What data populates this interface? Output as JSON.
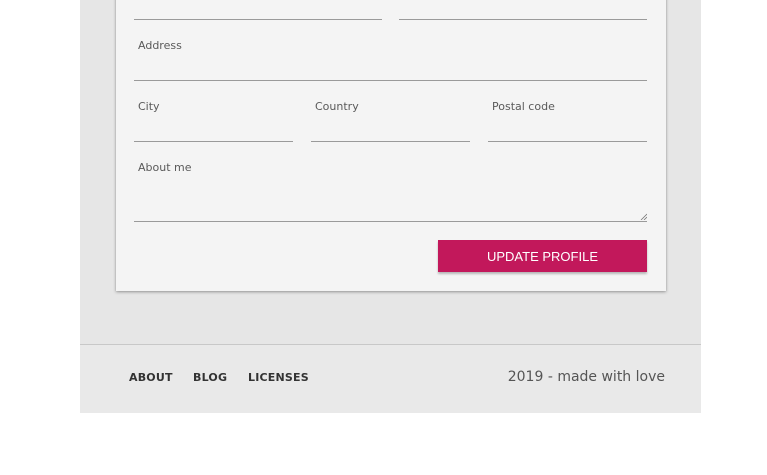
{
  "form": {
    "address_label": "Address",
    "city_label": "City",
    "country_label": "Country",
    "postal_code_label": "Postal code",
    "about_label": "About me",
    "submit_label": "UPDATE PROFILE"
  },
  "footer": {
    "links": [
      "ABOUT",
      "BLOG",
      "LICENSES"
    ],
    "copyright": "2019 - made with love"
  },
  "colors": {
    "accent": "#c2185b",
    "page_bg": "#e6e6e6",
    "card_bg": "#f4f4f4"
  }
}
